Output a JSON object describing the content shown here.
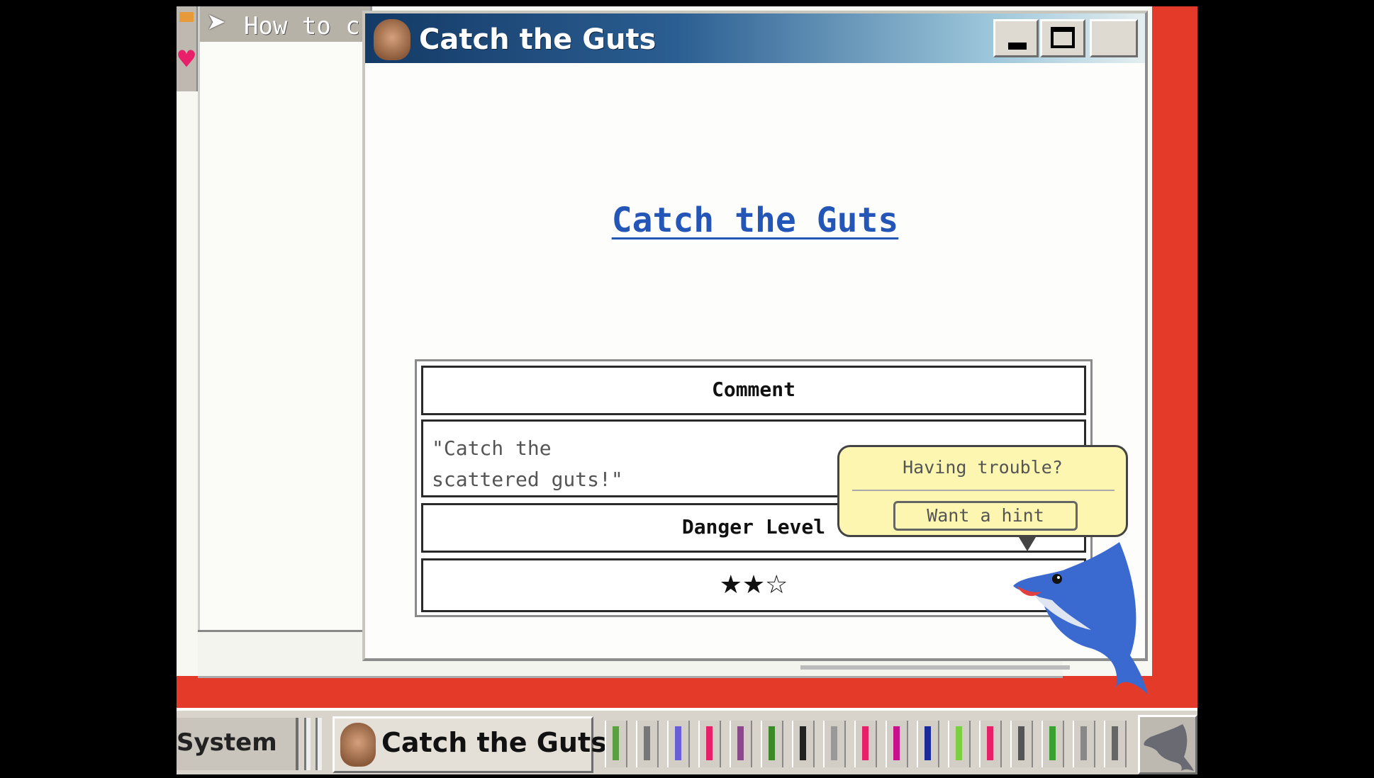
{
  "background_window": {
    "title": "How to c"
  },
  "main_window": {
    "title": "Catch the Guts",
    "heading": "Catch the Guts",
    "table": {
      "comment_header": "Comment",
      "comment_line1": "\"Catch the",
      "comment_line2": "scattered guts!\"",
      "danger_header": "Danger Level",
      "danger_stars": "★★☆",
      "danger_value": 2,
      "danger_max": 3
    }
  },
  "assistant": {
    "question": "Having trouble?",
    "hint_button": "Want a hint"
  },
  "taskbar": {
    "system_label": "System",
    "task_label": "Catch the Guts",
    "tray_colors": [
      "#5aa040",
      "#777",
      "#6a5ed8",
      "#e8206a",
      "#8a4a8a",
      "#3a8a2a",
      "#222",
      "#999",
      "#e8206a",
      "#c8108a",
      "#1a2a9a",
      "#7ad040",
      "#e8206a",
      "#555",
      "#3aa030",
      "#888",
      "#666"
    ]
  },
  "colors": {
    "desktop_red": "#e43a2a",
    "title_blue": "#143a66",
    "link_blue": "#2456b8",
    "bubble_yellow": "#fcf6b0"
  }
}
